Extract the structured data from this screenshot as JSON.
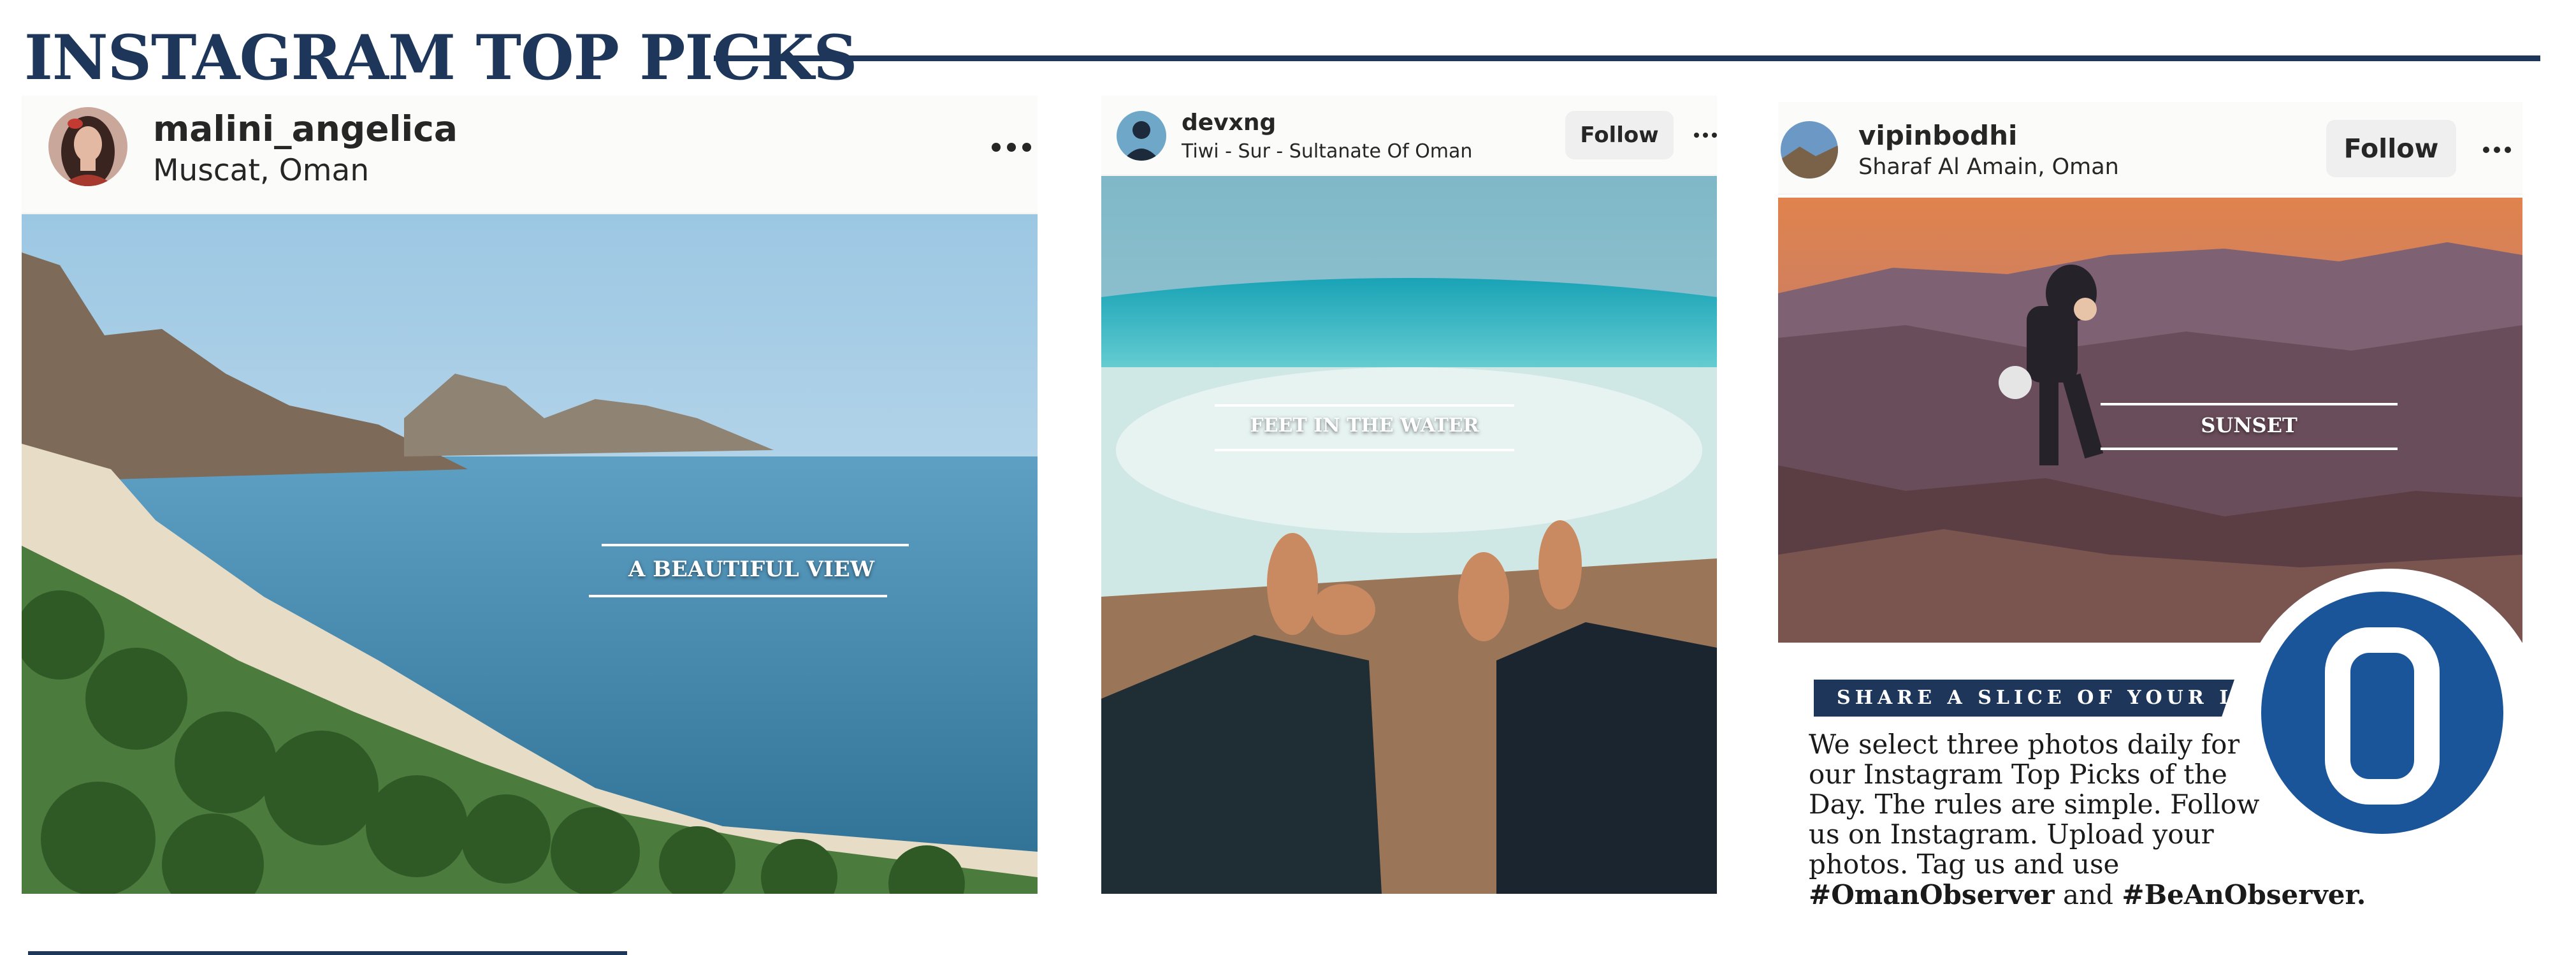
{
  "header": {
    "title": "INSTAGRAM TOP PICKS"
  },
  "posts": [
    {
      "username": "malini_angelica",
      "location": "Muscat, Oman",
      "caption": "A BEAUTIFUL VIEW",
      "avatar_icon": "avatar-woman-portrait"
    },
    {
      "username": "devxng",
      "location": "Tiwi - Sur - Sultanate Of Oman",
      "follow_label": "Follow",
      "caption": "FEET IN THE WATER",
      "avatar_icon": "avatar-person"
    },
    {
      "username": "vipinbodhi",
      "location": "Sharaf Al Amain, Oman",
      "follow_label": "Follow",
      "caption": "SUNSET",
      "avatar_icon": "avatar-landscape"
    }
  ],
  "promo": {
    "heading": "SHARE A SLICE OF YOUR LIFE",
    "body": "We select three photos daily for our Instagram Top Picks of the Day. The rules are simple. Follow us on Instagram. Upload your photos. Tag us and use",
    "tag1": "#OmanObserver",
    "conjunction": "and",
    "tag2": "#BeAnObserver."
  },
  "logo": {
    "icon": "observer-o-logo",
    "color": "#1a5599"
  },
  "colors": {
    "brand_navy": "#1e3659",
    "logo_blue": "#1a5599"
  }
}
